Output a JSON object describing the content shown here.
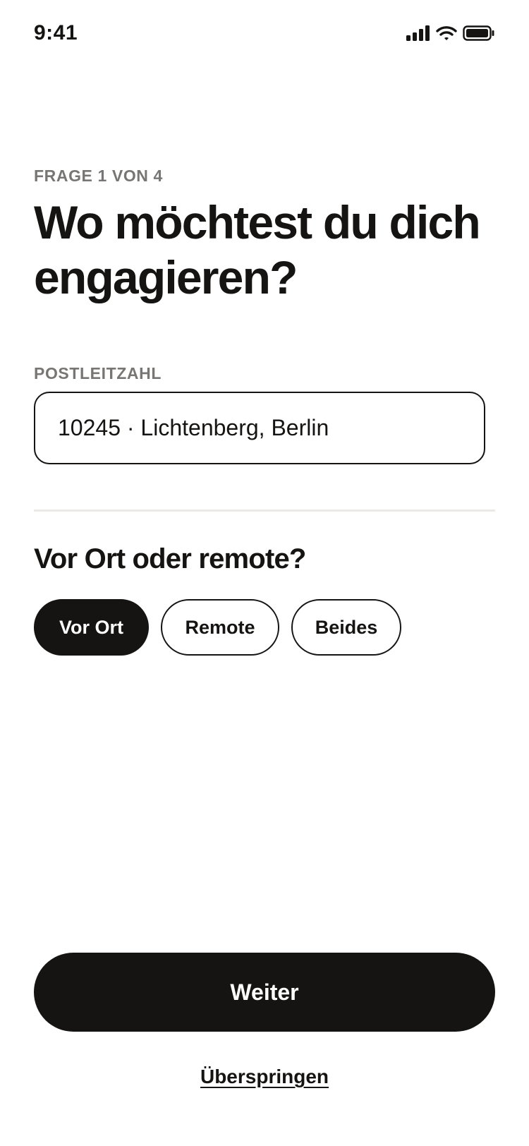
{
  "status_bar": {
    "time": "9:41",
    "icons": [
      "signal-icon",
      "wifi-icon",
      "battery-icon"
    ]
  },
  "progress": {
    "label": "FRAGE 1 VON 4",
    "current": 1,
    "total": 4
  },
  "question": {
    "title": "Wo möchtest du dich engagieren?"
  },
  "postal_code": {
    "label": "POSTLEITZAHL",
    "value": "10245 · Lichtenberg, Berlin"
  },
  "location_mode": {
    "title": "Vor Ort oder remote?",
    "options": [
      {
        "label": "Vor Ort",
        "selected": true
      },
      {
        "label": "Remote",
        "selected": false
      },
      {
        "label": "Beides",
        "selected": false
      }
    ]
  },
  "actions": {
    "continue_label": "Weiter",
    "skip_label": "Überspringen"
  },
  "colors": {
    "primary": "#151413",
    "muted_text": "#787674",
    "divider": "#ebe9e7",
    "background": "#ffffff"
  }
}
